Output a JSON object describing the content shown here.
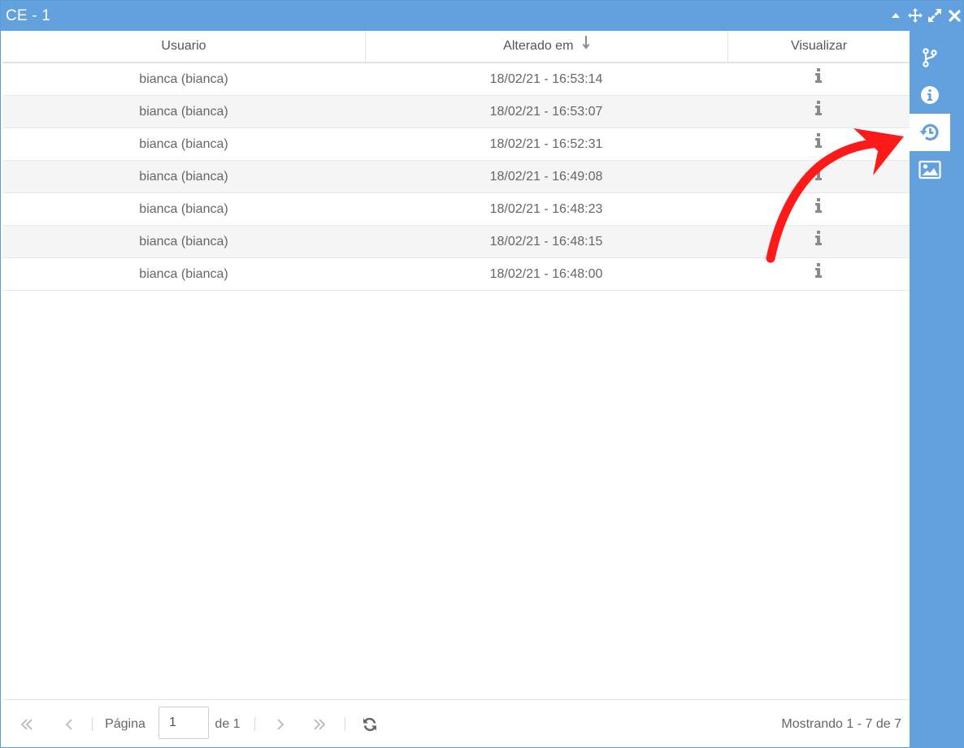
{
  "window": {
    "title": "CE - 1"
  },
  "table": {
    "columns": [
      "Usuario",
      "Alterado em",
      "Visualizar"
    ],
    "rows": [
      {
        "usuario": "bianca (bianca)",
        "alterado_em": "18/02/21 - 16:53:14"
      },
      {
        "usuario": "bianca (bianca)",
        "alterado_em": "18/02/21 - 16:53:07"
      },
      {
        "usuario": "bianca (bianca)",
        "alterado_em": "18/02/21 - 16:52:31"
      },
      {
        "usuario": "bianca (bianca)",
        "alterado_em": "18/02/21 - 16:49:08"
      },
      {
        "usuario": "bianca (bianca)",
        "alterado_em": "18/02/21 - 16:48:23"
      },
      {
        "usuario": "bianca (bianca)",
        "alterado_em": "18/02/21 - 16:48:15"
      },
      {
        "usuario": "bianca (bianca)",
        "alterado_em": "18/02/21 - 16:48:00"
      }
    ]
  },
  "pager": {
    "page_label": "Página",
    "page_value": "1",
    "of_label": "de 1",
    "summary": "Mostrando 1 - 7 de 7"
  },
  "sidebar": {
    "items": [
      "branch-icon",
      "info-circle-icon",
      "history-icon",
      "image-icon"
    ],
    "active": "history-icon"
  },
  "colors": {
    "accent": "#63a1de",
    "annotation": "#ff1a1a"
  }
}
